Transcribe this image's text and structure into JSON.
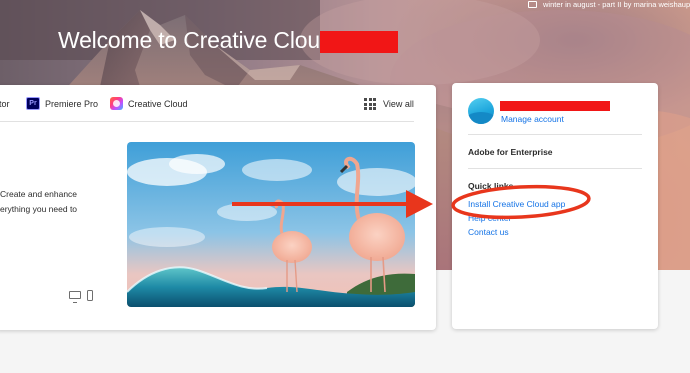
{
  "colors": {
    "accent_link": "#1473e6",
    "annotation_red": "#e8361c",
    "redaction_red": "#f11616"
  },
  "hero": {
    "welcome_text": "Welcome to Creative Cloud,",
    "credit_icon": "image-credit-icon",
    "credit_text": "winter in august - part II by marina weishaupt"
  },
  "apps_bar": {
    "items": [
      {
        "label": "ator",
        "icon": "illustrator-icon"
      },
      {
        "label": "Premiere Pro",
        "icon": "premiere-pro-icon",
        "badge": "Pr"
      },
      {
        "label": "Creative Cloud",
        "icon": "creative-cloud-icon"
      }
    ],
    "view_all_label": "View all",
    "view_all_icon": "grid-icon"
  },
  "featured": {
    "description_lines": [
      "Create and enhance",
      "erything you need to"
    ],
    "devices": [
      "desktop-icon",
      "mobile-icon"
    ]
  },
  "account": {
    "manage_account_label": "Manage account",
    "enterprise_label": "Adobe for Enterprise",
    "quick_links_heading": "Quick links",
    "quick_links": [
      "Install Creative Cloud app",
      "Help center",
      "Contact us"
    ]
  }
}
